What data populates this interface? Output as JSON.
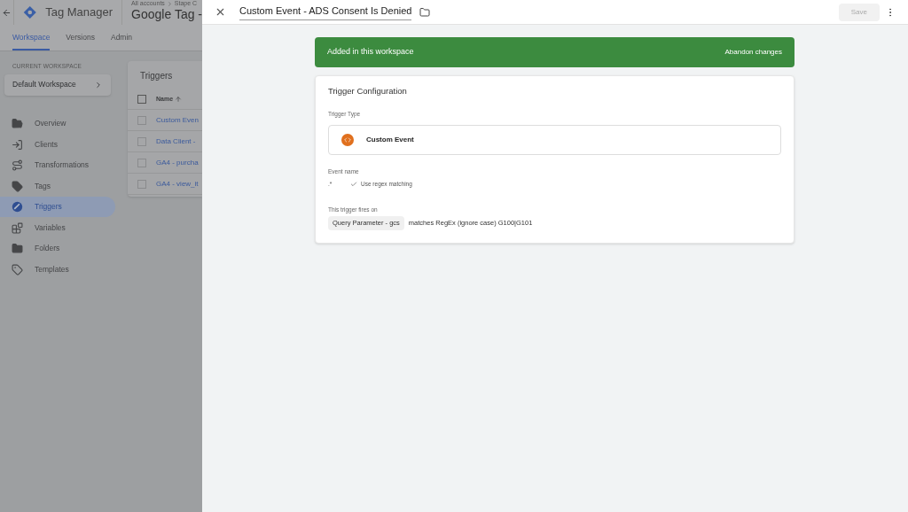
{
  "app": {
    "name": "Tag Manager",
    "breadcrumb": [
      "All accounts",
      "Stape C"
    ],
    "container": "Google Tag -"
  },
  "tabs": [
    {
      "label": "Workspace",
      "selected": true
    },
    {
      "label": "Versions",
      "selected": false
    },
    {
      "label": "Admin",
      "selected": false
    }
  ],
  "workspace": {
    "caption": "CURRENT WORKSPACE",
    "name": "Default Workspace"
  },
  "nav": [
    {
      "label": "Overview",
      "kind": "folder-open",
      "selected": false
    },
    {
      "label": "Clients",
      "kind": "client",
      "selected": false
    },
    {
      "label": "Transformations",
      "kind": "route",
      "selected": false
    },
    {
      "label": "Tags",
      "kind": "tag",
      "selected": false
    },
    {
      "label": "Triggers",
      "kind": "trigger",
      "selected": true
    },
    {
      "label": "Variables",
      "kind": "blocks",
      "selected": false
    },
    {
      "label": "Folders",
      "kind": "folder",
      "selected": false
    },
    {
      "label": "Templates",
      "kind": "template",
      "selected": false
    }
  ],
  "triggers": {
    "title": "Triggers",
    "column": "Name",
    "all_checked": false,
    "rows": [
      {
        "name": "Custom Even",
        "checked": false
      },
      {
        "name": "Data Client -",
        "checked": false
      },
      {
        "name": "GA4 - purcha",
        "checked": false
      },
      {
        "name": "GA4 - view_it",
        "checked": false
      }
    ]
  },
  "editor": {
    "title": "Custom Event - ADS Consent Is Denied",
    "save": "Save",
    "save_disabled": true,
    "banner": {
      "text": "Added in this workspace",
      "action": "Abandon changes"
    },
    "config": {
      "heading": "Trigger Configuration",
      "type_label": "Trigger Type",
      "type": "Custom Event",
      "event_label": "Event name",
      "event_value": ".*",
      "regex_label": "Use regex matching",
      "regex_checked": true,
      "fires_label": "This trigger fires on",
      "condition_variable": "Query Parameter - gcs",
      "condition_text": "matches RegEx (ignore case) G100|G101"
    }
  }
}
